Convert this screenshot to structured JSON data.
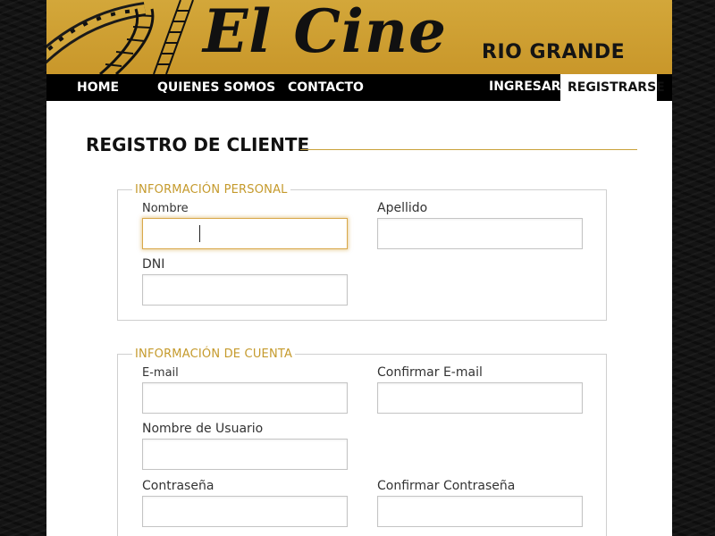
{
  "header": {
    "logo_text": "El Cine",
    "city": "RIO GRANDE"
  },
  "nav": {
    "home": "HOME",
    "about": "QUIENES SOMOS",
    "contact": "CONTACTO",
    "login": "INGRESAR",
    "register": "REGISTRARSE"
  },
  "page": {
    "title": "REGISTRO DE CLIENTE"
  },
  "personal": {
    "legend": "INFORMACIÓN PERSONAL",
    "nombre_label": "Nombre",
    "nombre_value": "",
    "apellido_label": "Apellido",
    "apellido_value": "",
    "dni_label": "DNI",
    "dni_value": ""
  },
  "account": {
    "legend": "INFORMACIÓN DE CUENTA",
    "email_label": "E-mail",
    "email_value": "",
    "confirm_email_label": "Confirmar E-mail",
    "confirm_email_value": "",
    "username_label": "Nombre de Usuario",
    "username_value": "",
    "password_label": "Contraseña",
    "password_value": "",
    "confirm_password_label": "Confirmar Contraseña",
    "confirm_password_value": ""
  },
  "colors": {
    "brand_gold": "#c9972a",
    "legend_gold": "#c59a2c",
    "nav_black": "#000000",
    "focus_glow": "#d9a84a"
  },
  "icons": {
    "header_art": "film-strip-icon"
  }
}
